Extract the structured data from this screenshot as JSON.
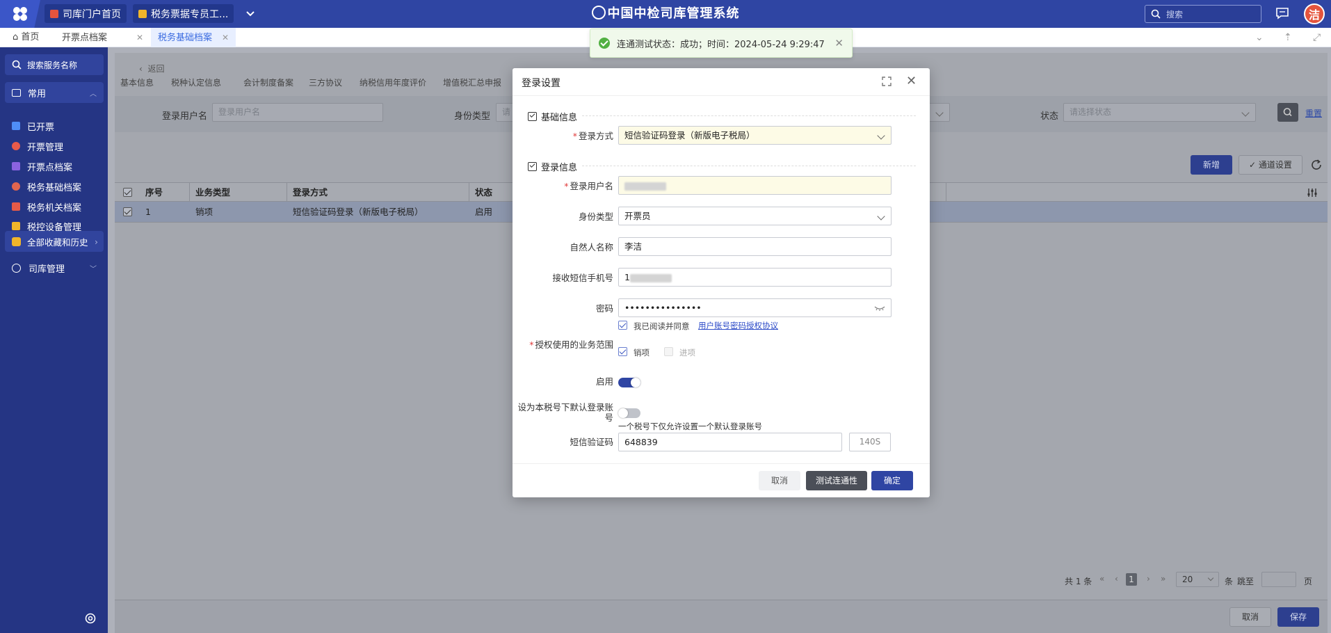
{
  "topbar": {
    "tabs": [
      {
        "label": "司库门户首页"
      },
      {
        "label": "税务票据专员工..."
      }
    ],
    "system_title": "中国中检司库管理系统",
    "search_placeholder": "搜索",
    "avatar_text": "洁"
  },
  "page_tabs": [
    {
      "label": "首页"
    },
    {
      "label": "开票点档案"
    },
    {
      "label": "税务基础档案"
    }
  ],
  "sidebar": {
    "search_label": "搜索服务名称",
    "common_label": "常用",
    "items": [
      {
        "label": "已开票",
        "color": "#4f8ef7"
      },
      {
        "label": "开票管理",
        "color": "#e85a4a"
      },
      {
        "label": "开票点档案",
        "color": "#8a63e0"
      },
      {
        "label": "税务基础档案",
        "color": "#e0654f"
      },
      {
        "label": "税务机关档案",
        "color": "#e55a48"
      },
      {
        "label": "税控设备管理",
        "color": "#f0b52a"
      }
    ],
    "favorites_label": "全部收藏和历史",
    "treasury_label": "司库管理"
  },
  "main": {
    "back_label": "返回",
    "subtabs": [
      "基本信息",
      "税种认定信息",
      "会计制度备案",
      "三方协议",
      "纳税信用年度评价",
      "增值税汇总申报"
    ],
    "filter": {
      "username_label": "登录用户名",
      "username_placeholder": "登录用户名",
      "idtype_label": "身份类型",
      "idtype_placeholder": "请",
      "status_label": "状态",
      "status_placeholder": "请选择状态",
      "reset_label": "重置"
    },
    "new_label": "新增",
    "channel_label": "通道设置",
    "table": {
      "headers": [
        "序号",
        "业务类型",
        "登录方式",
        "状态"
      ],
      "rows": [
        {
          "index": "1",
          "business": "销项",
          "login": "短信验证码登录（新版电子税局）",
          "status": "启用"
        }
      ]
    },
    "pager": {
      "total": "共 1 条",
      "current": "1",
      "page_size": "20",
      "unit": "条",
      "jump": "跳至",
      "page": "页"
    },
    "cancel_label": "取消",
    "save_label": "保存"
  },
  "toast": {
    "text": "连通测试状态：成功；时间：2024-05-24 9:29:47"
  },
  "modal": {
    "title": "登录设置",
    "section_basic": "基础信息",
    "login_method_label": "登录方式",
    "login_method_value": "短信验证码登录（新版电子税局）",
    "section_login": "登录信息",
    "username_label": "登录用户名",
    "idtype_label": "身份类型",
    "idtype_value": "开票员",
    "person_label": "自然人名称",
    "person_value": "李洁",
    "phone_label": "接收短信手机号",
    "phone_prefix": "1",
    "password_label": "密码",
    "password_value": "•••••••••••••••",
    "agree_text": "我已阅读并同意",
    "agree_link": "用户账号密码授权协议",
    "scope_label": "授权使用的业务范围",
    "scope_options": [
      "销项",
      "进项"
    ],
    "enable_label": "启用",
    "default_label": "设为本税号下默认登录账号",
    "default_hint": "一个税号下仅允许设置一个默认登录账号",
    "sms_label": "短信验证码",
    "sms_value": "648839",
    "countdown": "140S",
    "cancel_label": "取消",
    "test_label": "测试连通性",
    "confirm_label": "确定"
  }
}
